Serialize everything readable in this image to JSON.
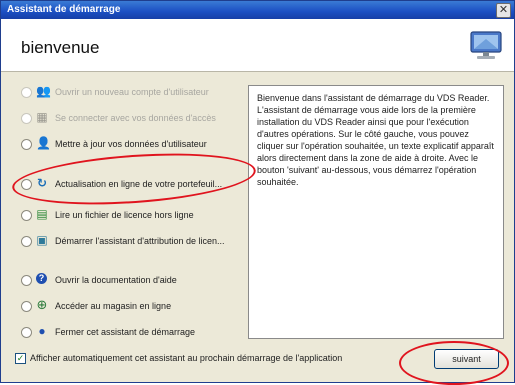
{
  "window": {
    "title": "Assistant de démarrage",
    "close_glyph": "✕"
  },
  "header": {
    "heading": "bienvenue",
    "logo_icon": "monitor-logo-icon"
  },
  "options": [
    {
      "label": "Ouvrir un nouveau compte d'utilisateur",
      "icon": "user-account-icon",
      "glyph": "👥",
      "color": "#9a9890",
      "enabled": false
    },
    {
      "label": "Se connecter avec vos données d'accès",
      "icon": "login-icon",
      "glyph": "▦",
      "color": "#9a9890",
      "enabled": false
    },
    {
      "label": "Mettre à jour vos données d'utilisateur",
      "icon": "user-edit-icon",
      "glyph": "👤",
      "color": "#2f5f2f",
      "enabled": true
    },
    {
      "label": "Actualisation en ligne de votre portefeuil...",
      "icon": "online-update-icon",
      "glyph": "↻",
      "color": "#1b6fb8",
      "enabled": true
    },
    {
      "label": "Lire un fichier de licence hors ligne",
      "icon": "license-file-icon",
      "glyph": "▤",
      "color": "#2f8a3a",
      "enabled": true
    },
    {
      "label": "Démarrer l'assistant d'attribution de licen...",
      "icon": "license-wizard-icon",
      "glyph": "▣",
      "color": "#2f7a9a",
      "enabled": true
    },
    {
      "label": "Ouvrir la documentation d'aide",
      "icon": "help-icon",
      "glyph": "?",
      "color": "#1f4fb0",
      "enabled": true
    },
    {
      "label": "Accéder au magasin en ligne",
      "icon": "online-store-icon",
      "glyph": "⊕",
      "color": "#2a7a3a",
      "enabled": true
    },
    {
      "label": "Fermer cet assistant de démarrage",
      "icon": "close-wizard-icon",
      "glyph": "●",
      "color": "#1f4fb0",
      "enabled": true
    }
  ],
  "description": "Bienvenue dans l'assistant de démarrage du VDS Reader. L'assistant de démarrage vous aide lors de la première installation du VDS Reader ainsi que pour l'exécution d'autres opérations. Sur le côté gauche, vous pouvez cliquer sur l'opération souhaitée, un texte explicatif apparaît alors directement dans la zone de aide à droite. Avec le bouton 'suivant' au-dessous, vous démarrez l'opération souhaitée.",
  "autostart": {
    "label": "Afficher automatiquement cet assistant au prochain démarrage de l'application",
    "checked": true,
    "check_glyph": "✓"
  },
  "next_button": "suivant",
  "colors": {
    "titlebar": "#1b4fc3",
    "annotation": "#e0141e"
  }
}
